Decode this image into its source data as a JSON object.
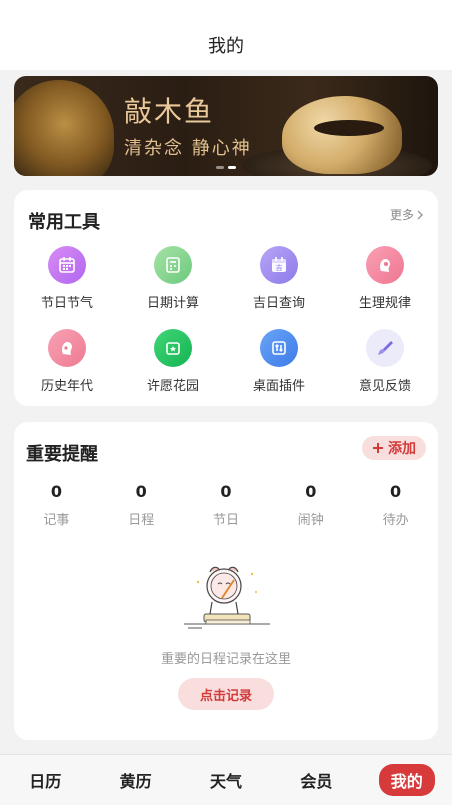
{
  "header": {
    "title": "我的"
  },
  "banner": {
    "title": "敲木鱼",
    "subtitle": "清杂念 静心神",
    "slides": 2,
    "active_slide": 1
  },
  "tools": {
    "title": "常用工具",
    "more_label": "更多",
    "items": [
      {
        "label": "节日节气",
        "icon": "calendar-icon",
        "color": "#c77ef2"
      },
      {
        "label": "日期计算",
        "icon": "calculator-icon",
        "color": "#7fd58a"
      },
      {
        "label": "吉日查询",
        "icon": "calendar-search-icon",
        "color": "#a890f4"
      },
      {
        "label": "生理规律",
        "icon": "female-profile-icon",
        "color": "#f58aa2"
      },
      {
        "label": "历史年代",
        "icon": "history-profile-icon",
        "color": "#f38aa0"
      },
      {
        "label": "许愿花园",
        "icon": "garden-icon",
        "color": "#2ec66a"
      },
      {
        "label": "桌面插件",
        "icon": "widget-icon",
        "color": "#4e8ff0"
      },
      {
        "label": "意见反馈",
        "icon": "brush-icon",
        "color": "#e6e4f8"
      }
    ]
  },
  "reminders": {
    "title": "重要提醒",
    "add_label": "添加",
    "stats": [
      {
        "value": "0",
        "label": "记事"
      },
      {
        "value": "0",
        "label": "日程"
      },
      {
        "value": "0",
        "label": "节日"
      },
      {
        "value": "0",
        "label": "闹钟"
      },
      {
        "value": "0",
        "label": "待办"
      }
    ],
    "empty_text": "重要的日程记录在这里",
    "record_label": "点击记录"
  },
  "tabbar": {
    "items": [
      {
        "label": "日历"
      },
      {
        "label": "黄历"
      },
      {
        "label": "天气"
      },
      {
        "label": "会员"
      },
      {
        "label": "我的"
      }
    ],
    "active_index": 4
  },
  "colors": {
    "accent": "#d63a3a",
    "accent_soft": "#f9dede"
  }
}
